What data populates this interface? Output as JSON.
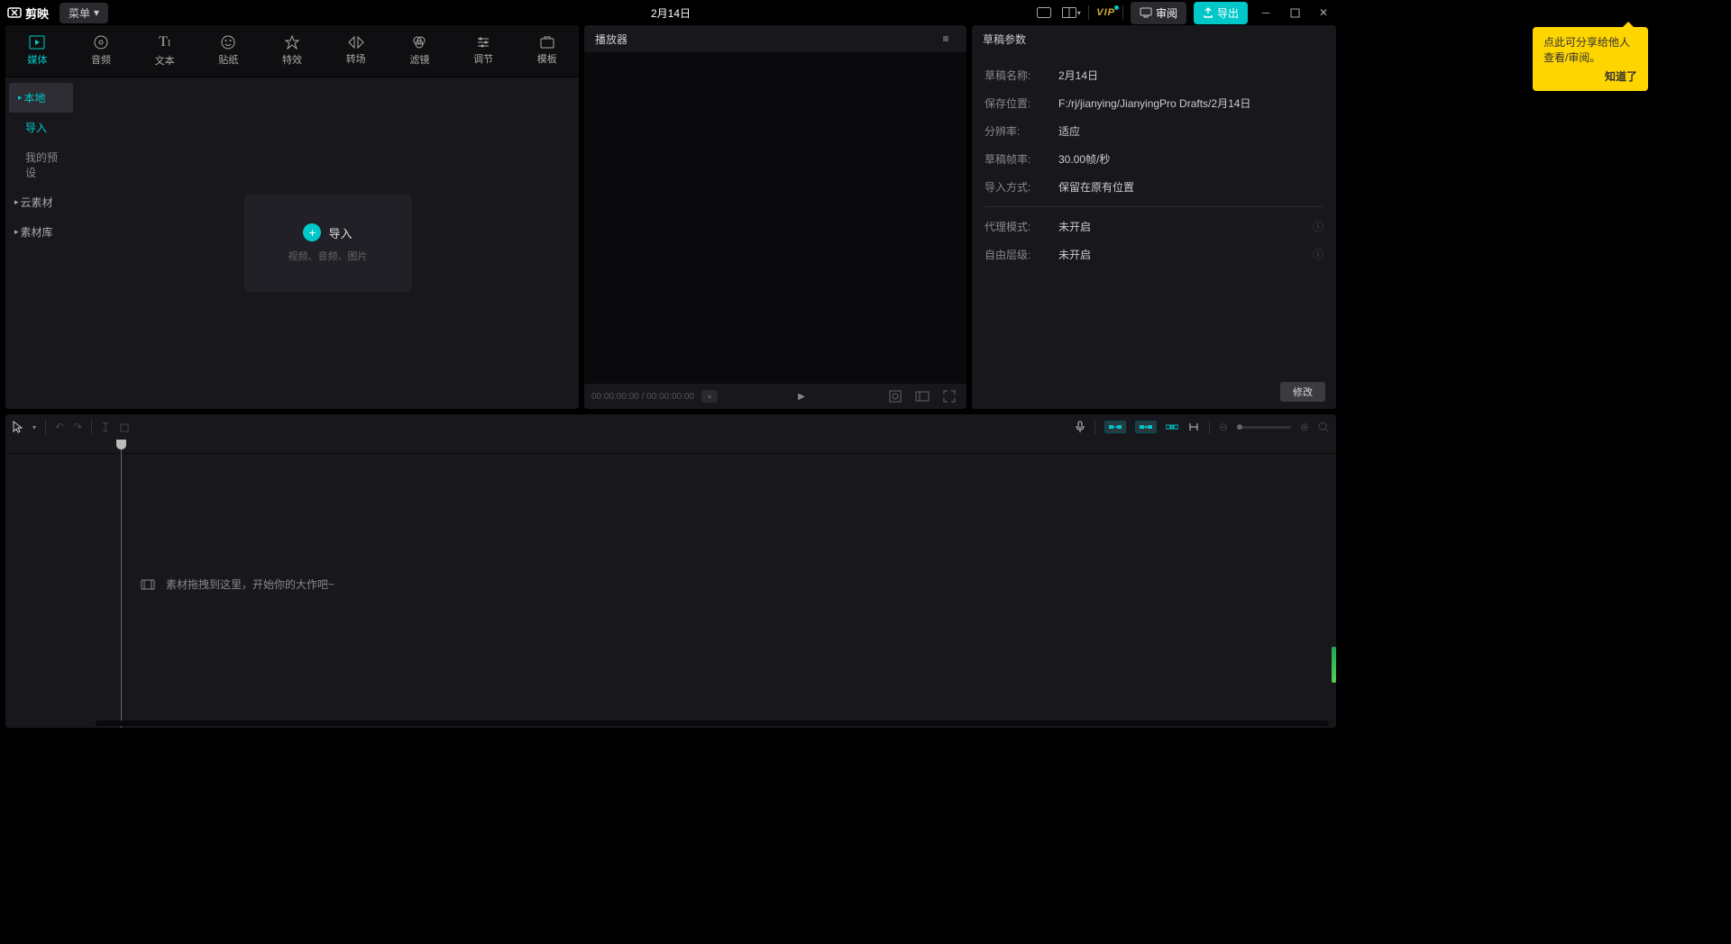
{
  "app": {
    "name": "剪映",
    "menu": "菜单",
    "title": "2月14日"
  },
  "titleButtons": {
    "review": "审阅",
    "export": "导出",
    "vip": "VIP"
  },
  "tabs": [
    {
      "icon": "▸",
      "label": "媒体"
    },
    {
      "icon": "♪",
      "label": "音频"
    },
    {
      "icon": "T",
      "label": "文本"
    },
    {
      "icon": "☺",
      "label": "贴纸"
    },
    {
      "icon": "✦",
      "label": "特效"
    },
    {
      "icon": "⋈",
      "label": "转场"
    },
    {
      "icon": "◎",
      "label": "滤镜"
    },
    {
      "icon": "⇄",
      "label": "调节"
    },
    {
      "icon": "▭",
      "label": "模板"
    }
  ],
  "sidebar": {
    "local": "本地",
    "import": "导入",
    "presets": "我的预设",
    "cloud": "云素材",
    "library": "素材库"
  },
  "importBox": {
    "label": "导入",
    "hint": "视频、音频、图片"
  },
  "player": {
    "title": "播放器",
    "time": "00:00:00:00 / 00:00:00:00"
  },
  "props": {
    "title": "草稿参数",
    "rows": {
      "name_l": "草稿名称:",
      "name_v": "2月14日",
      "path_l": "保存位置:",
      "path_v": "F:/rj/jianying/JianyingPro Drafts/2月14日",
      "res_l": "分辨率:",
      "res_v": "适应",
      "fps_l": "草稿帧率:",
      "fps_v": "30.00帧/秒",
      "imp_l": "导入方式:",
      "imp_v": "保留在原有位置",
      "proxy_l": "代理模式:",
      "proxy_v": "未开启",
      "layer_l": "自由层级:",
      "layer_v": "未开启"
    },
    "modify": "修改"
  },
  "tooltip": {
    "text": "点此可分享给他人查看/审阅。",
    "action": "知道了"
  },
  "timeline": {
    "hint": "素材拖拽到这里，开始你的大作吧~"
  }
}
